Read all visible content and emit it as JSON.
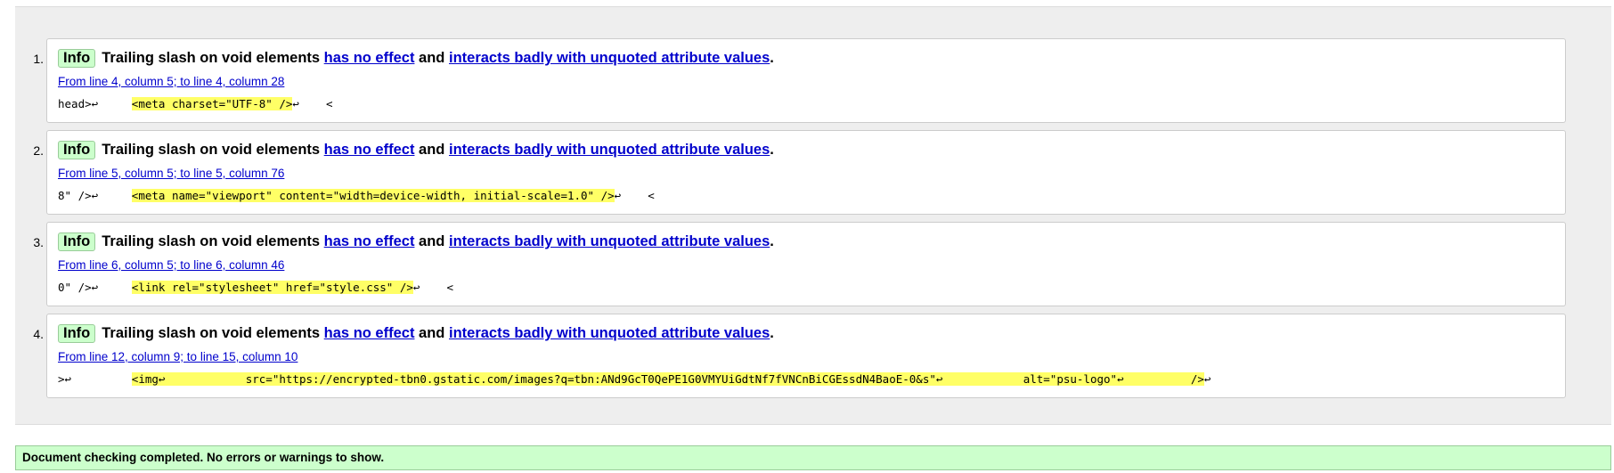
{
  "messages": [
    {
      "num": "1.",
      "badge": "Info",
      "text": "Trailing slash on void elements",
      "link1": "has no effect",
      "conj": "and",
      "link2": "interacts badly with unquoted attribute values",
      "period": ".",
      "location": "From line 4, column 5; to line 4, column 28",
      "pre": "head>↩     ",
      "code": "<meta charset=\"UTF-8\" />",
      "post": "↩    <"
    },
    {
      "num": "2.",
      "badge": "Info",
      "text": "Trailing slash on void elements",
      "link1": "has no effect",
      "conj": "and",
      "link2": "interacts badly with unquoted attribute values",
      "period": ".",
      "location": "From line 5, column 5; to line 5, column 76",
      "pre": "8\" />↩     ",
      "code": "<meta name=\"viewport\" content=\"width=device-width, initial-scale=1.0\" />",
      "post": "↩    <"
    },
    {
      "num": "3.",
      "badge": "Info",
      "text": "Trailing slash on void elements",
      "link1": "has no effect",
      "conj": "and",
      "link2": "interacts badly with unquoted attribute values",
      "period": ".",
      "location": "From line 6, column 5; to line 6, column 46",
      "pre": "0\" />↩     ",
      "code": "<link rel=\"stylesheet\" href=\"style.css\" />",
      "post": "↩    <"
    },
    {
      "num": "4.",
      "badge": "Info",
      "text": "Trailing slash on void elements",
      "link1": "has no effect",
      "conj": "and",
      "link2": "interacts badly with unquoted attribute values",
      "period": ".",
      "location": "From line 12, column 9; to line 15, column 10",
      "pre": ">↩         ",
      "code": "<img↩            src=\"https://encrypted-tbn0.gstatic.com/images?q=tbn:ANd9GcT0QePE1G0VMYUiGdtNf7fVNCnBiCGEssdN4BaoE-0&s\"↩            alt=\"psu-logo\"↩          />",
      "post": "↩"
    }
  ],
  "summary": "Document checking completed. No errors or warnings to show.",
  "colors": {
    "info_badge_bg": "#ccffcc",
    "highlight": "#ffff66",
    "link": "#0000cc",
    "summary_bg": "#ccffcc"
  }
}
